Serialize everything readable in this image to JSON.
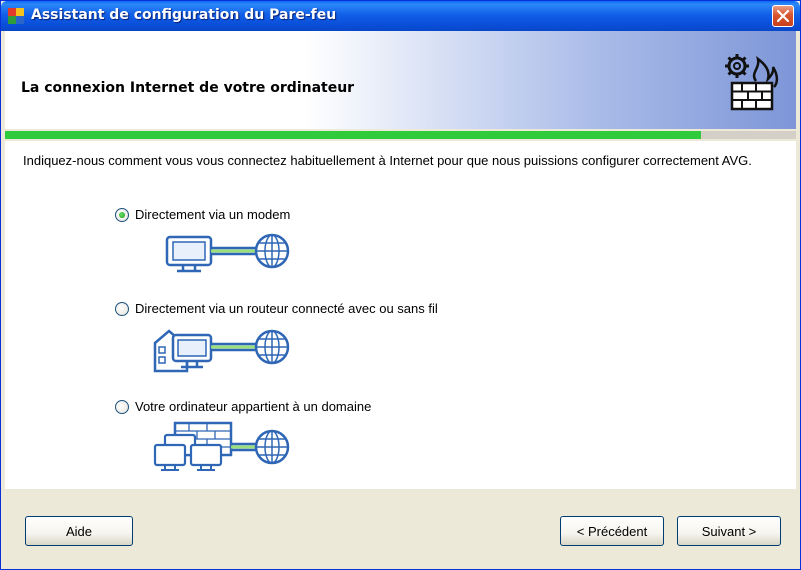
{
  "window": {
    "title": "Assistant de configuration du Pare-feu"
  },
  "header": {
    "title": "La connexion Internet de votre ordinateur",
    "icon": "firewall-gear-flame-icon"
  },
  "progress": {
    "fraction": 0.88,
    "color": "#2FCB3A"
  },
  "content": {
    "intro": "Indiquez-nous comment vous vous connectez habituellement à Internet pour que nous puissions configurer correctement AVG.",
    "options": [
      {
        "label": "Directement via un modem",
        "selected": true,
        "icon": "computer-modem-globe-icon"
      },
      {
        "label": "Directement via un routeur connecté avec ou sans fil",
        "selected": false,
        "icon": "house-computer-globe-icon"
      },
      {
        "label": "Votre ordinateur appartient à un domaine",
        "selected": false,
        "icon": "network-computers-globe-icon"
      }
    ]
  },
  "buttons": {
    "help": "Aide",
    "back": "< Précédent",
    "next": "Suivant >"
  },
  "colors": {
    "titlebar": "#0A4ED8",
    "accent_green": "#2FCB3A",
    "illustration_blue": "#2F67B6",
    "dialog_bg": "#ECE9D8"
  }
}
